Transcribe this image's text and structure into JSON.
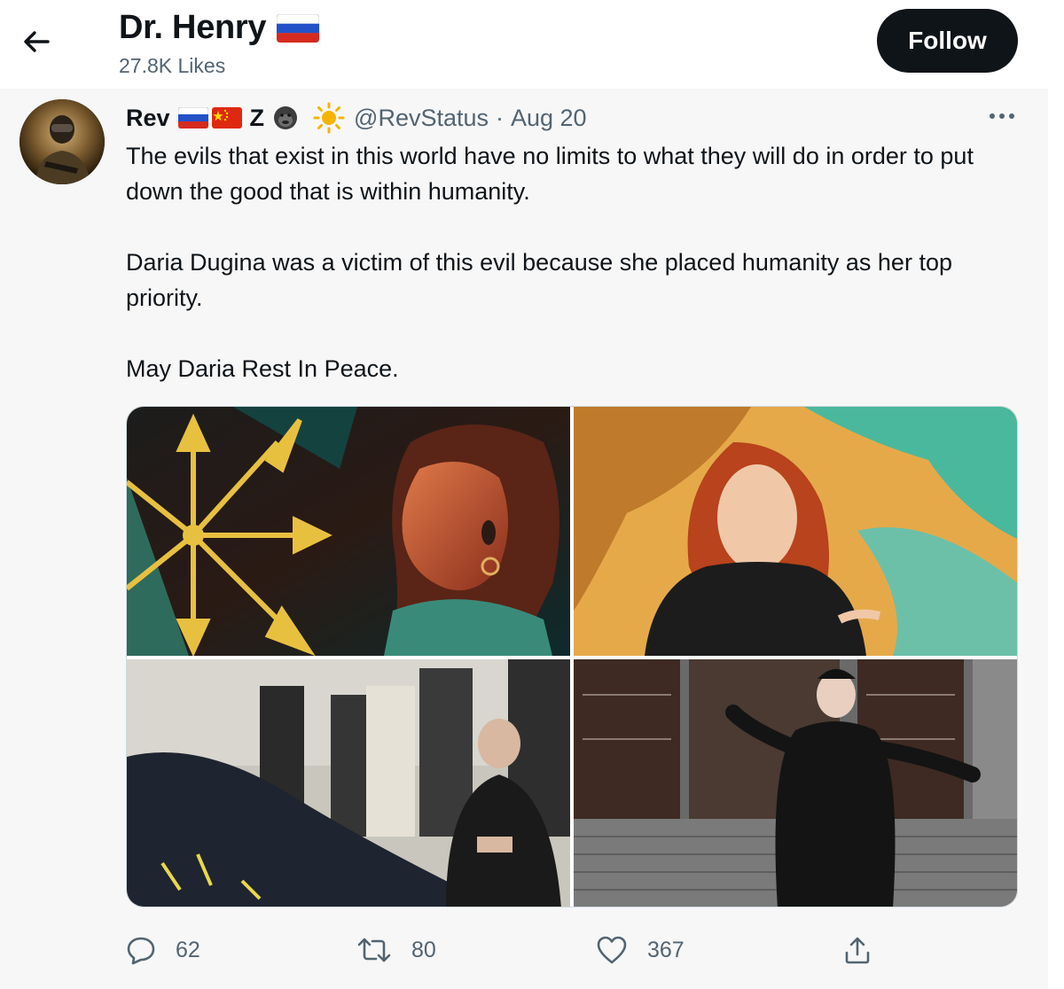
{
  "header": {
    "profile_name": "Dr. Henry",
    "likes": "27.8K Likes",
    "follow_label": "Follow"
  },
  "tweet": {
    "author_name": "Rev",
    "author_badges": [
      "russia-flag",
      "china-flag",
      "Z",
      "gorilla-emoji",
      "sun-emoji"
    ],
    "z_letter": "Z",
    "handle": "@RevStatus",
    "separator": "·",
    "date": "Aug 20",
    "paragraphs": [
      "The evils that exist in this world have no limits to what they will do in order to put down the good that is within humanity.",
      "Daria Dugina was a victim of this evil  because she placed humanity as her top priority.",
      "May Daria Rest In Peace."
    ],
    "media_count": 4,
    "actions": {
      "replies": "62",
      "retweets": "80",
      "likes": "367"
    }
  },
  "icons": {
    "back": "arrow-left-icon",
    "more": "more-dots-icon",
    "reply": "speech-bubble-icon",
    "retweet": "retweet-arrows-icon",
    "like": "heart-icon",
    "share": "share-upload-icon"
  },
  "colors": {
    "follow_bg": "#0f1419",
    "muted_text": "#536471",
    "tweet_bg": "#f7f7f7",
    "sun": "#f5b400"
  }
}
